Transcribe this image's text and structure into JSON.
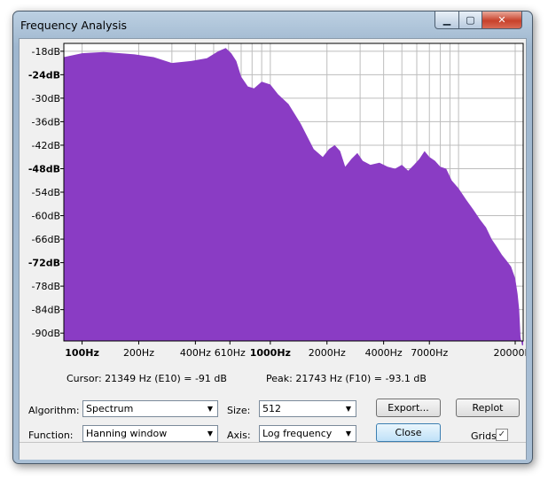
{
  "window": {
    "title": "Frequency Analysis",
    "minimize_glyph": "▁",
    "maximize_glyph": "▢",
    "close_glyph": "✕"
  },
  "chart_data": {
    "type": "area",
    "x_scale": "log",
    "xlim": [
      80,
      22050
    ],
    "ylim": [
      -92,
      -16
    ],
    "y_ticks": [
      "-18dB",
      "-24dB",
      "-30dB",
      "-36dB",
      "-42dB",
      "-48dB",
      "-54dB",
      "-60dB",
      "-66dB",
      "-72dB",
      "-78dB",
      "-84dB",
      "-90dB"
    ],
    "x_ticks": [
      {
        "label": "100Hz",
        "value": 100,
        "bold": true
      },
      {
        "label": "200Hz",
        "value": 200,
        "bold": false
      },
      {
        "label": "400Hz",
        "value": 400,
        "bold": false
      },
      {
        "label": "610Hz",
        "value": 610,
        "bold": false
      },
      {
        "label": "1000Hz",
        "value": 1000,
        "bold": true
      },
      {
        "label": "2000Hz",
        "value": 2000,
        "bold": false
      },
      {
        "label": "4000Hz",
        "value": 4000,
        "bold": false
      },
      {
        "label": "7000Hz",
        "value": 7000,
        "bold": false
      },
      {
        "label": "20000Hz",
        "value": 20000,
        "bold": false
      }
    ],
    "grid": true,
    "fill_color": "#8a3cc4",
    "series": [
      {
        "x": [
          80,
          100,
          130,
          160,
          190,
          240,
          300,
          380,
          460,
          530,
          580,
          620,
          660,
          700,
          760,
          820,
          900,
          1000,
          1100,
          1250,
          1450,
          1700,
          1900,
          2050,
          2200,
          2350,
          2500,
          2700,
          2900,
          3100,
          3400,
          3800,
          4200,
          4600,
          5000,
          5400,
          5800,
          6200,
          6600,
          7000,
          7500,
          8000,
          8600,
          9200,
          10000,
          11000,
          12000,
          13000,
          14000,
          15000,
          16000,
          17000,
          18000,
          19000,
          20000,
          20600,
          21000,
          21349,
          21743,
          22050
        ],
        "y": [
          -19.5,
          -18.5,
          -18.2,
          -18.5,
          -18.8,
          -19.5,
          -21.0,
          -20.5,
          -19.8,
          -18.0,
          -17.2,
          -18.5,
          -20.5,
          -24.5,
          -27.0,
          -27.5,
          -25.8,
          -26.5,
          -29.0,
          -31.5,
          -36.5,
          -43.0,
          -45.0,
          -43.0,
          -42.0,
          -43.5,
          -47.5,
          -45.5,
          -44.0,
          -46.0,
          -47.0,
          -46.5,
          -47.5,
          -48.0,
          -47.0,
          -48.5,
          -47.0,
          -45.5,
          -43.5,
          -45.0,
          -46.0,
          -47.5,
          -48.0,
          -51.0,
          -53.0,
          -56.0,
          -58.5,
          -61.0,
          -63.0,
          -66.0,
          -68.0,
          -70.0,
          -71.5,
          -73.0,
          -76.0,
          -80.0,
          -84.0,
          -91.0,
          -93.1,
          -93.1
        ]
      }
    ]
  },
  "readout": {
    "cursor": "Cursor: 21349 Hz (E10) = -91 dB",
    "peak": "Peak: 21743 Hz (F10) = -93.1 dB"
  },
  "controls": {
    "algorithm_label": "Algorithm:",
    "algorithm_value": "Spectrum",
    "size_label": "Size:",
    "size_value": "512",
    "function_label": "Function:",
    "function_value": "Hanning window",
    "axis_label": "Axis:",
    "axis_value": "Log frequency",
    "export_label": "Export...",
    "replot_label": "Replot",
    "close_label": "Close",
    "grids_label": "Grids",
    "grids_checked_glyph": "✓",
    "dropdown_arrow_glyph": "▼"
  }
}
